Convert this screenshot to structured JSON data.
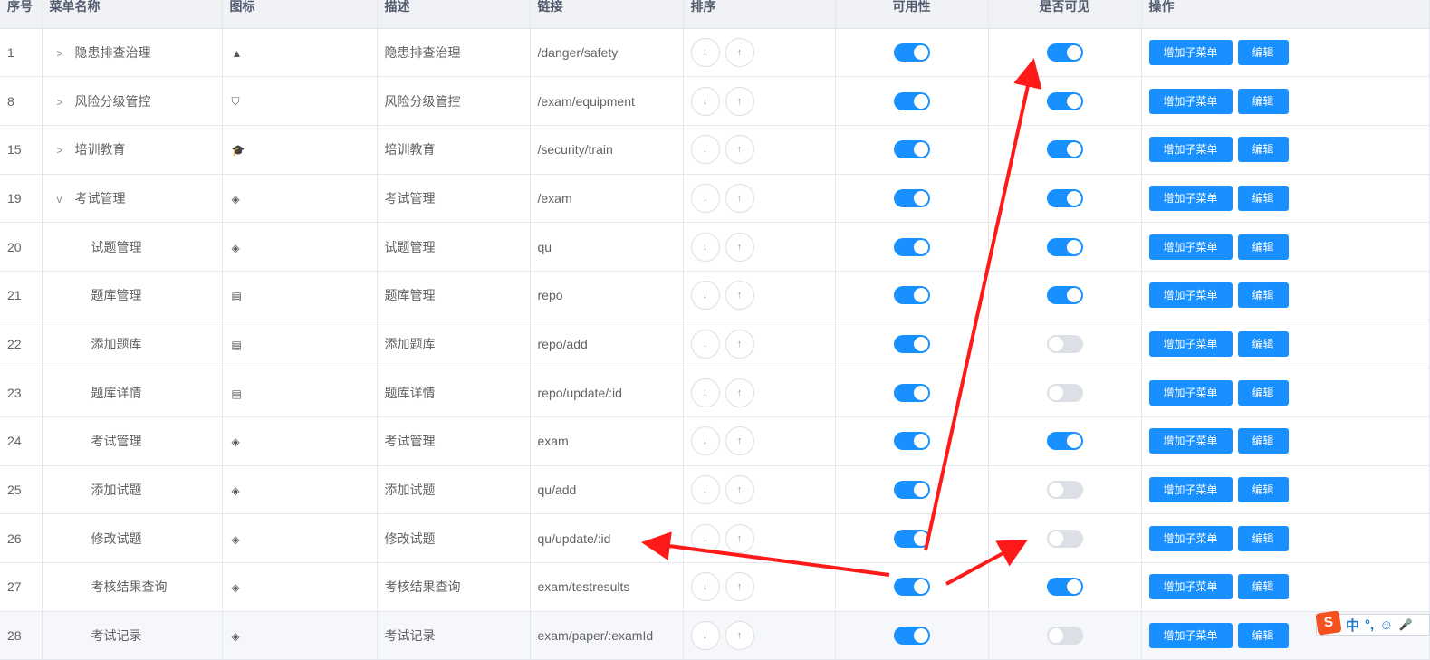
{
  "headers": [
    "序号",
    "菜单名称",
    "图标",
    "描述",
    "链接",
    "排序",
    "可用性",
    "是否可见",
    "操作"
  ],
  "rows": [
    {
      "id": "1",
      "name": "隐患排查治理",
      "expander": ">",
      "icon": "warning-icon",
      "desc": "隐患排查治理",
      "link": "/danger/safety",
      "enabled": true,
      "visible": true
    },
    {
      "id": "8",
      "name": "风险分级管控",
      "expander": ">",
      "icon": "shield-icon",
      "desc": "风险分级管控",
      "link": "/exam/equipment",
      "enabled": true,
      "visible": true
    },
    {
      "id": "15",
      "name": "培训教育",
      "expander": ">",
      "icon": "graduation-cap-icon",
      "desc": "培训教育",
      "link": "/security/train",
      "enabled": true,
      "visible": true
    },
    {
      "id": "19",
      "name": "考试管理",
      "expander": "v",
      "icon": "stack-icon",
      "desc": "考试管理",
      "link": "/exam",
      "enabled": true,
      "visible": true
    },
    {
      "id": "20",
      "name": "试题管理",
      "icon": "stack-icon",
      "desc": "试题管理",
      "link": "qu",
      "enabled": true,
      "visible": true
    },
    {
      "id": "21",
      "name": "题库管理",
      "icon": "form-icon",
      "desc": "题库管理",
      "link": "repo",
      "enabled": true,
      "visible": true
    },
    {
      "id": "22",
      "name": "添加题库",
      "icon": "form-icon",
      "desc": "添加题库",
      "link": "repo/add",
      "enabled": true,
      "visible": false
    },
    {
      "id": "23",
      "name": "题库详情",
      "icon": "form-icon",
      "desc": "题库详情",
      "link": "repo/update/:id",
      "enabled": true,
      "visible": false
    },
    {
      "id": "24",
      "name": "考试管理",
      "icon": "stack-icon",
      "desc": "考试管理",
      "link": "exam",
      "enabled": true,
      "visible": true
    },
    {
      "id": "25",
      "name": "添加试题",
      "icon": "stack-icon",
      "desc": "添加试题",
      "link": "qu/add",
      "enabled": true,
      "visible": false
    },
    {
      "id": "26",
      "name": "修改试题",
      "icon": "stack-icon",
      "desc": "修改试题",
      "link": "qu/update/:id",
      "enabled": true,
      "visible": false
    },
    {
      "id": "27",
      "name": "考核结果查询",
      "icon": "stack-icon",
      "desc": "考核结果查询",
      "link": "exam/testresults",
      "enabled": true,
      "visible": true
    },
    {
      "id": "28",
      "name": "考试记录",
      "icon": "stack-icon",
      "desc": "考试记录",
      "link": "exam/paper/:examId",
      "enabled": true,
      "visible": false
    }
  ],
  "actions": {
    "add_child": "增加子菜单",
    "edit": "编辑",
    "sort_down": "↓",
    "sort_up": "↑"
  },
  "ime": {
    "logo": "S",
    "mode": "中",
    "punct": "°,",
    "emoji": "☺",
    "mic": "🎤"
  },
  "colors": {
    "primary": "#1890ff",
    "annotation": "#ff1a1a"
  }
}
